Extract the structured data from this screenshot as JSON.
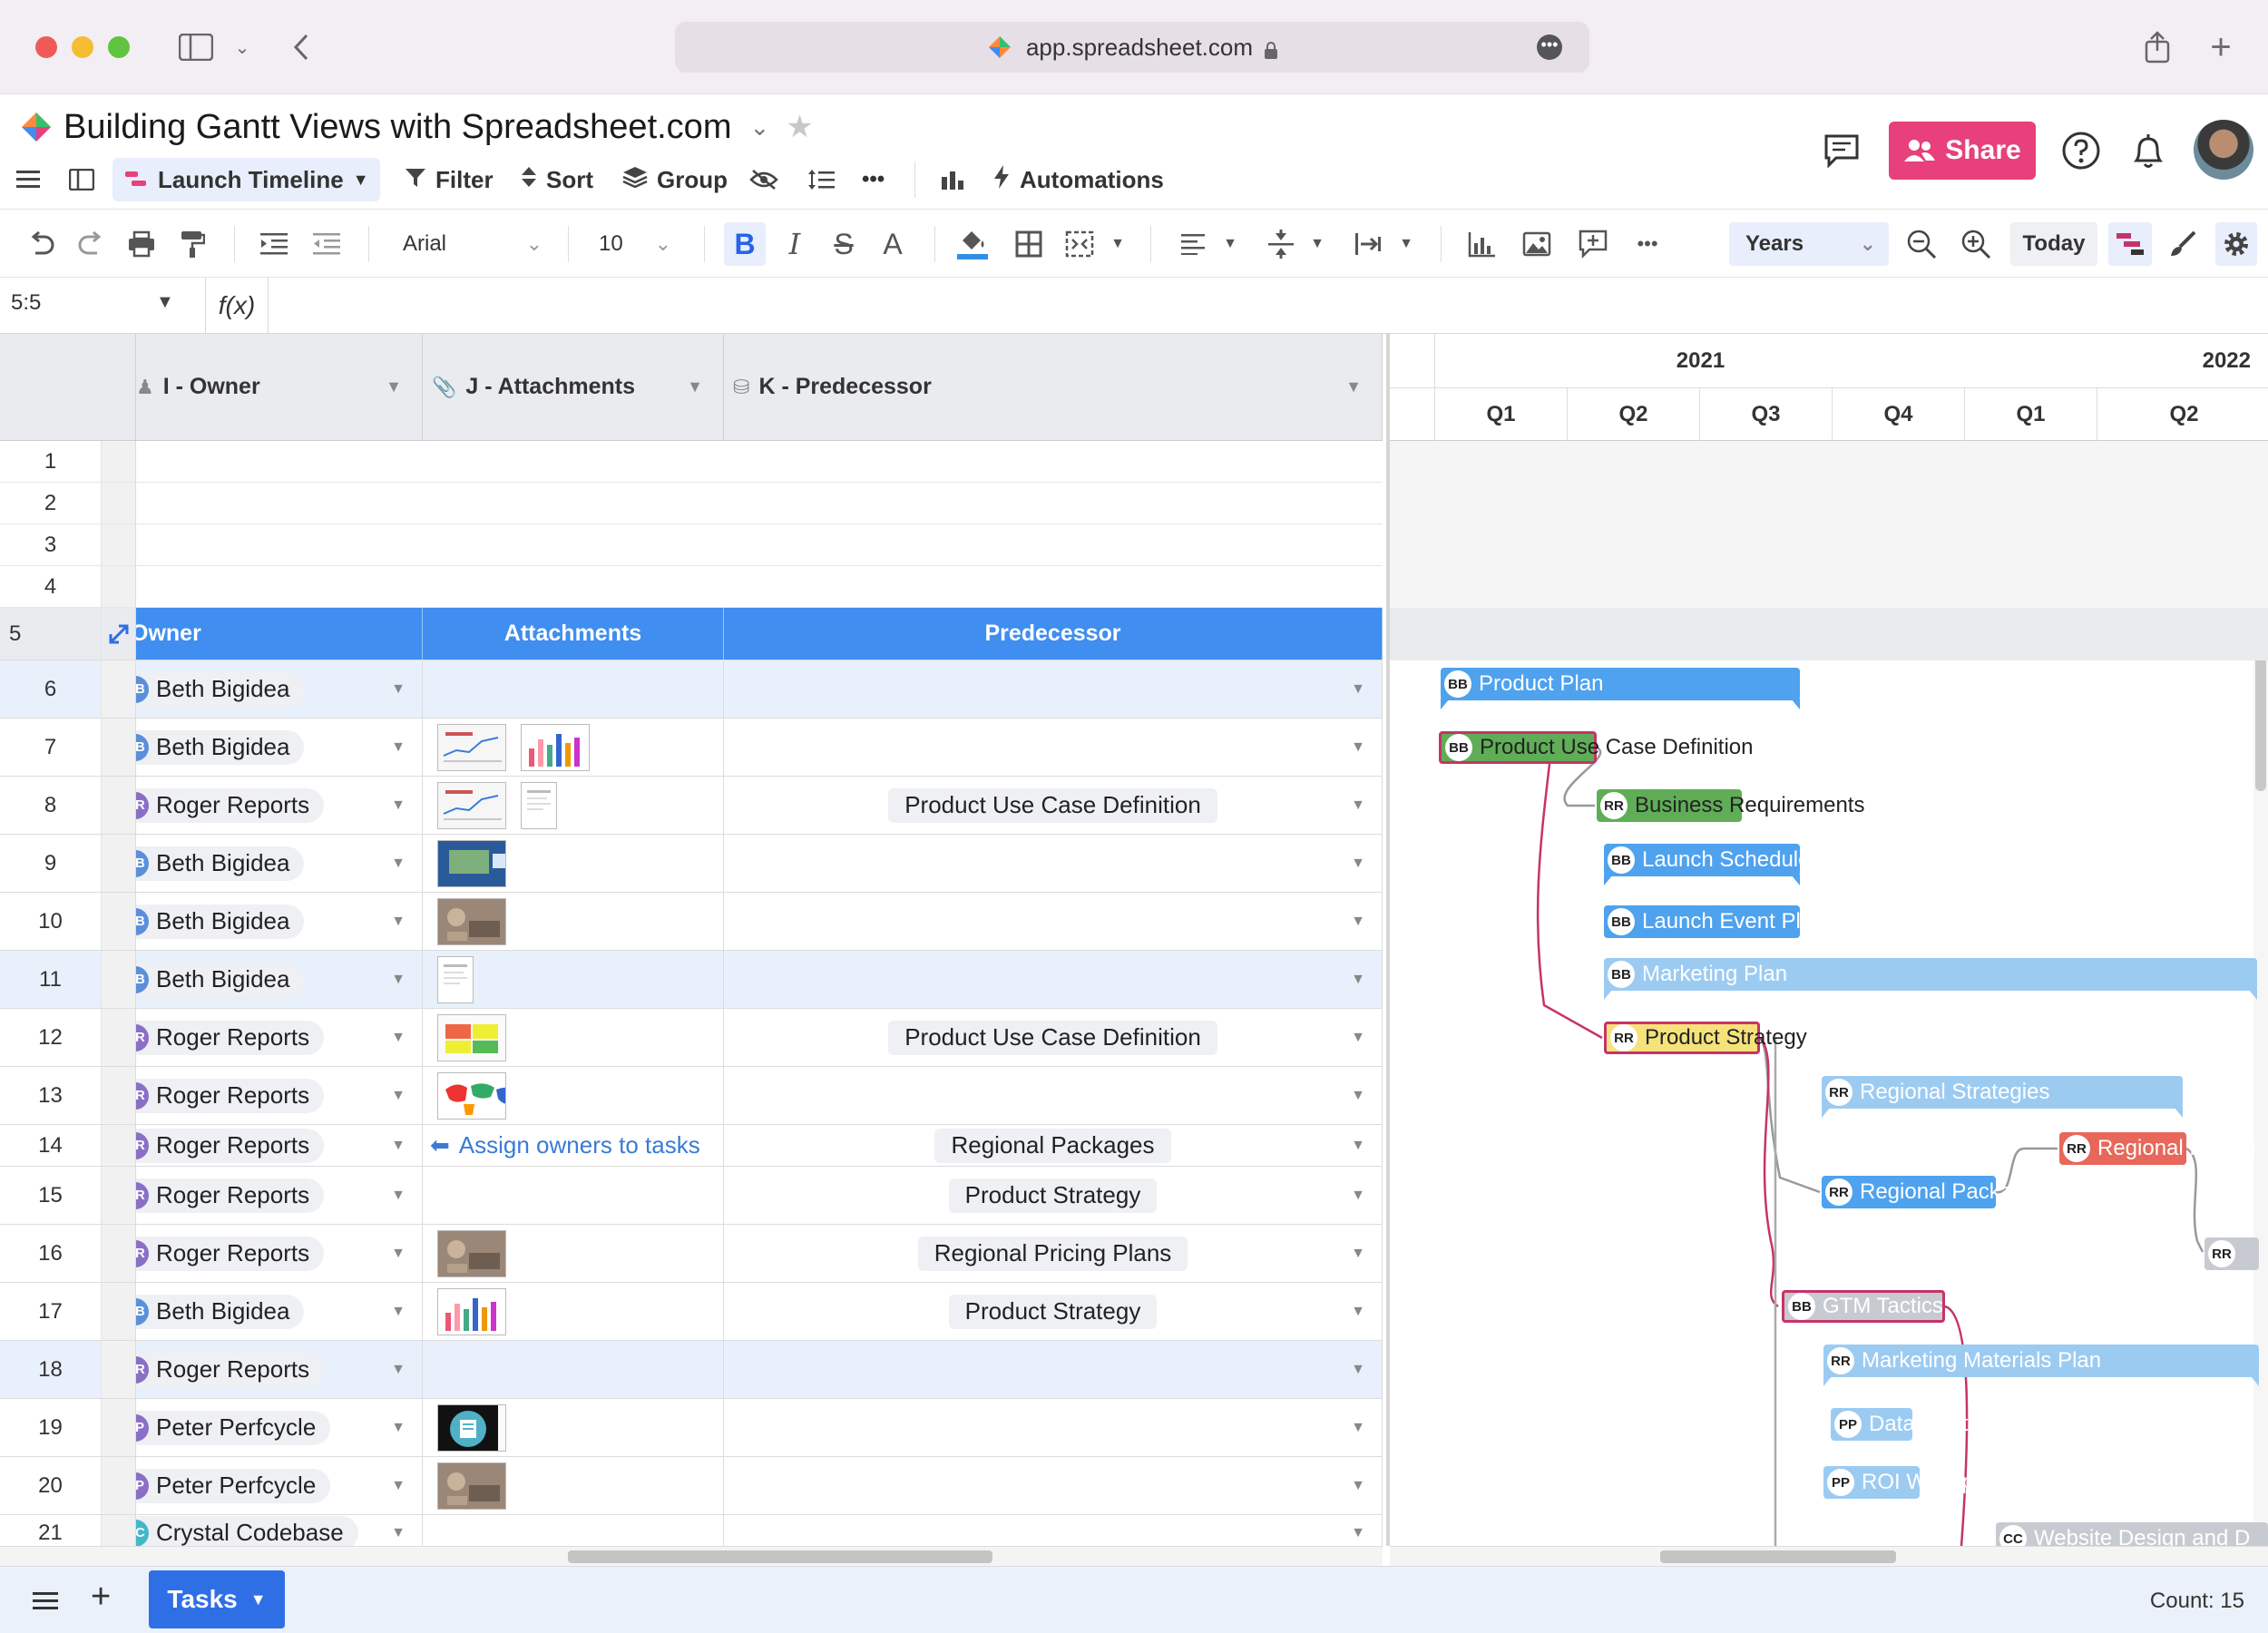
{
  "browser": {
    "url": "app.spreadsheet.com",
    "more": "•••"
  },
  "header": {
    "doc_title": "Building Gantt Views with Spreadsheet.com",
    "view_name": "Launch Timeline",
    "filter": "Filter",
    "sort": "Sort",
    "group": "Group",
    "automations": "Automations",
    "share": "Share"
  },
  "toolbar": {
    "font": "Arial",
    "font_size": "10",
    "bold": "B",
    "italic": "I",
    "strike": "S",
    "text_color": "A",
    "more": "•••",
    "timescale": "Years",
    "today": "Today"
  },
  "formula_bar": {
    "cell_ref": "5:5",
    "fx": "f(x)"
  },
  "columns": [
    {
      "id": "owner",
      "header": "I - Owner",
      "subheader": "Owner"
    },
    {
      "id": "attachments",
      "header": "J - Attachments",
      "subheader": "Attachments"
    },
    {
      "id": "predecessor",
      "header": "K - Predecessor",
      "subheader": "Predecessor"
    }
  ],
  "row_numbers": [
    "1",
    "2",
    "3",
    "4",
    "5",
    "6",
    "7",
    "8",
    "9",
    "10",
    "11",
    "12",
    "13",
    "14",
    "15",
    "16",
    "17",
    "18",
    "19",
    "20",
    "21"
  ],
  "rows": [
    {
      "num": "6",
      "owner": "Beth Bigidea",
      "ini": "BB",
      "color": "#5b8fd9",
      "attachments": [],
      "predecessor": "",
      "highlight": true
    },
    {
      "num": "7",
      "owner": "Beth Bigidea",
      "ini": "BB",
      "color": "#5b8fd9",
      "attachments": [
        "chart",
        "bars"
      ],
      "predecessor": ""
    },
    {
      "num": "8",
      "owner": "Roger Reports",
      "ini": "RR",
      "color": "#8a6fc6",
      "attachments": [
        "chart",
        "doc"
      ],
      "predecessor": "Product Use Case Definition"
    },
    {
      "num": "9",
      "owner": "Beth Bigidea",
      "ini": "BB",
      "color": "#5b8fd9",
      "attachments": [
        "map"
      ],
      "predecessor": ""
    },
    {
      "num": "10",
      "owner": "Beth Bigidea",
      "ini": "BB",
      "color": "#5b8fd9",
      "attachments": [
        "photo"
      ],
      "predecessor": ""
    },
    {
      "num": "11",
      "owner": "Beth Bigidea",
      "ini": "BB",
      "color": "#5b8fd9",
      "attachments": [
        "doc"
      ],
      "predecessor": "",
      "highlight": true
    },
    {
      "num": "12",
      "owner": "Roger Reports",
      "ini": "RR",
      "color": "#8a6fc6",
      "attachments": [
        "grid"
      ],
      "predecessor": "Product Use Case Definition"
    },
    {
      "num": "13",
      "owner": "Roger Reports",
      "ini": "RR",
      "color": "#8a6fc6",
      "attachments": [
        "world"
      ],
      "predecessor": ""
    },
    {
      "num": "14",
      "owner": "Roger Reports",
      "ini": "RR",
      "color": "#8a6fc6",
      "attachments": [],
      "link": "Assign owners to tasks",
      "predecessor": "Regional Packages"
    },
    {
      "num": "15",
      "owner": "Roger Reports",
      "ini": "RR",
      "color": "#8a6fc6",
      "attachments": [],
      "predecessor": "Product Strategy"
    },
    {
      "num": "16",
      "owner": "Roger Reports",
      "ini": "RR",
      "color": "#8a6fc6",
      "attachments": [
        "photo"
      ],
      "predecessor": "Regional Pricing Plans"
    },
    {
      "num": "17",
      "owner": "Beth Bigidea",
      "ini": "BB",
      "color": "#5b8fd9",
      "attachments": [
        "bars"
      ],
      "predecessor": "Product Strategy"
    },
    {
      "num": "18",
      "owner": "Roger Reports",
      "ini": "RR",
      "color": "#8a6fc6",
      "attachments": [],
      "predecessor": "",
      "highlight": true
    },
    {
      "num": "19",
      "owner": "Peter Perfcycle",
      "ini": "PP",
      "color": "#8a6fc6",
      "attachments": [
        "icon"
      ],
      "predecessor": ""
    },
    {
      "num": "20",
      "owner": "Peter Perfcycle",
      "ini": "PP",
      "color": "#8a6fc6",
      "attachments": [
        "photo"
      ],
      "predecessor": ""
    },
    {
      "num": "21",
      "owner": "Crystal Codebase",
      "ini": "CC",
      "color": "#43b8c9",
      "attachments": [],
      "predecessor": ""
    }
  ],
  "gantt": {
    "years": [
      {
        "label": "2021"
      },
      {
        "label": "2022"
      }
    ],
    "quarters": [
      "Q1",
      "Q2",
      "Q3",
      "Q4",
      "Q1",
      "Q2"
    ],
    "tasks": [
      {
        "ini": "BB",
        "label": "Product Plan"
      },
      {
        "ini": "BB",
        "label": "Product Use Case Definition"
      },
      {
        "ini": "RR",
        "label": "Business Requirements"
      },
      {
        "ini": "BB",
        "label": "Launch Schedule"
      },
      {
        "ini": "BB",
        "label": "Launch Event Plan"
      },
      {
        "ini": "BB",
        "label": "Marketing Plan"
      },
      {
        "ini": "RR",
        "label": "Product Strategy"
      },
      {
        "ini": "RR",
        "label": "Regional Strategies"
      },
      {
        "ini": "RR",
        "label": "Regional Pricing"
      },
      {
        "ini": "RR",
        "label": "Regional Packages"
      },
      {
        "ini": "RR",
        "label": ""
      },
      {
        "ini": "BB",
        "label": "GTM Tactics"
      },
      {
        "ini": "RR",
        "label": "Marketing Materials Plan"
      },
      {
        "ini": "PP",
        "label": "Datasheets"
      },
      {
        "ini": "PP",
        "label": "ROI Whitepaper"
      },
      {
        "ini": "CC",
        "label": "Website Design and D"
      }
    ]
  },
  "footer": {
    "sheet_tab": "Tasks",
    "count": "Count: 15"
  }
}
